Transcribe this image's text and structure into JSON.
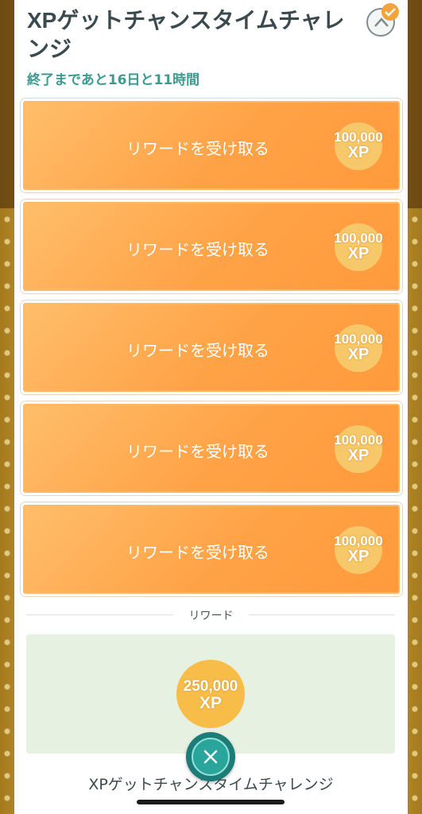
{
  "challenge": {
    "title": "XPゲットチャンスタイムチャレンジ",
    "time_remaining": "終了まであと16日と11時間"
  },
  "reward_buttons": [
    {
      "label": "リワードを受け取る",
      "xp_amount": "100,000",
      "xp_unit": "XP"
    },
    {
      "label": "リワードを受け取る",
      "xp_amount": "100,000",
      "xp_unit": "XP"
    },
    {
      "label": "リワードを受け取る",
      "xp_amount": "100,000",
      "xp_unit": "XP"
    },
    {
      "label": "リワードを受け取る",
      "xp_amount": "100,000",
      "xp_unit": "XP"
    },
    {
      "label": "リワードを受け取る",
      "xp_amount": "100,000",
      "xp_unit": "XP"
    }
  ],
  "reward_section": {
    "heading": "リワード",
    "xp_amount": "250,000",
    "xp_unit": "XP"
  },
  "footer": {
    "name": "XPゲットチャンスタイムチャレンジ"
  },
  "icons": {
    "collapse": "chevron-up-icon",
    "completed": "check-icon",
    "close": "close-icon"
  },
  "colors": {
    "accent_teal": "#3c9a8f",
    "reward_orange": "#ffa246",
    "coin_gold": "#f8bd49",
    "reward_box_bg": "#e6f1e2"
  }
}
